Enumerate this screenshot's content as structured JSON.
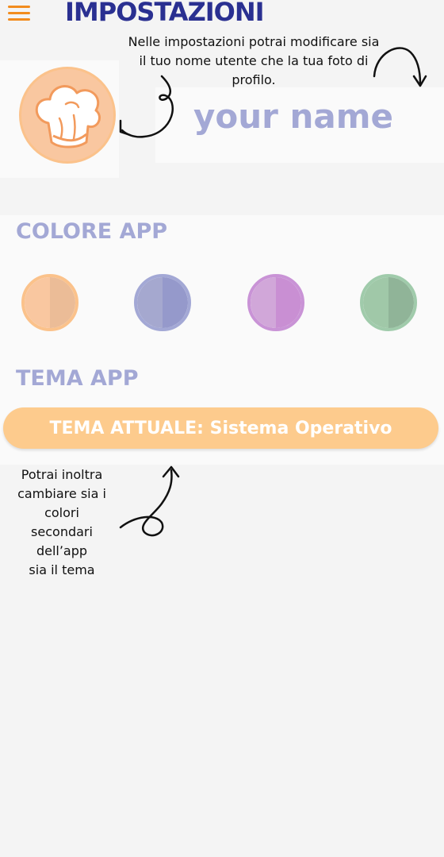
{
  "header": {
    "menu_icon": "hamburger-menu-icon",
    "title": "IMPOSTAZIONI"
  },
  "profile": {
    "avatar_icon": "chef-hat-icon",
    "name_placeholder": "your name"
  },
  "annotations": {
    "top_note_lines": [
      "Nelle impostazioni potrai modificare sia",
      "il tuo nome utente che la tua foto di",
      "profilo."
    ],
    "bottom_note_lines": [
      "Potrai inoltra",
      "cambiare sia i",
      "colori",
      "secondari",
      "dell’app",
      "sia il tema"
    ]
  },
  "app_color": {
    "title": "COLORE APP",
    "swatches": [
      {
        "name": "orange",
        "ring": "#fbc28b",
        "left": "#f9c7a0",
        "right": "#ebbc97"
      },
      {
        "name": "blue",
        "ring": "#a3a8d5",
        "left": "#a5a8cf",
        "right": "#9599cb"
      },
      {
        "name": "purple",
        "ring": "#c993d6",
        "left": "#d1a7d9",
        "right": "#c98fd3"
      },
      {
        "name": "green",
        "ring": "#a0cbab",
        "left": "#a0c8a8",
        "right": "#90b498"
      }
    ]
  },
  "app_theme": {
    "title": "TEMA APP",
    "button_label": "TEMA ATTUALE: Sistema Operativo"
  },
  "colors": {
    "accent_orange": "#f28c1e",
    "title_navy": "#2a3091",
    "muted_blue": "#a3a8d5",
    "theme_button": "#fdcb8d"
  }
}
